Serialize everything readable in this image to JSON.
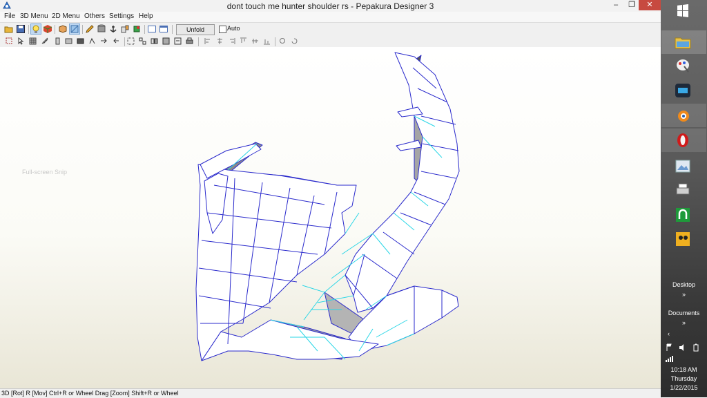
{
  "window": {
    "title": "dont touch me hunter shoulder rs - Pepakura Designer 3",
    "minimize_glyph": "–",
    "maximize_glyph": "❐",
    "close_glyph": "✕"
  },
  "menu": {
    "items": [
      "File",
      "3D Menu",
      "2D Menu",
      "Others",
      "Settings",
      "Help"
    ]
  },
  "toolbar": {
    "unfold_label": "Unfold",
    "auto_label": "Auto",
    "auto_checked": false
  },
  "viewport": {
    "snip_label": "Full-screen Snip"
  },
  "statusbar": {
    "text": "3D [Rot] R [Mov] Ctrl+R or Wheel Drag [Zoom] Shift+R or Wheel"
  },
  "taskbar": {
    "pinned": [
      "windows-start-icon",
      "file-explorer-icon",
      "paint-icon",
      "app-icon",
      "blender-icon",
      "opera-icon",
      "photo-viewer-icon",
      "printer-icon",
      "app-green-icon",
      "camera-icon"
    ],
    "desktop_label": "Desktop",
    "documents_label": "Documents",
    "expand_glyph": "»",
    "left_glyph": "‹",
    "time": "10:18 AM",
    "day": "Thursday",
    "date": "1/22/2015"
  },
  "colors": {
    "mesh_edge": "#2a2acc",
    "fold_edge": "#2ad6e6",
    "mesh_face": "#ffffff",
    "mesh_shade": "#9a9a9a",
    "close_button": "#c74a40"
  }
}
